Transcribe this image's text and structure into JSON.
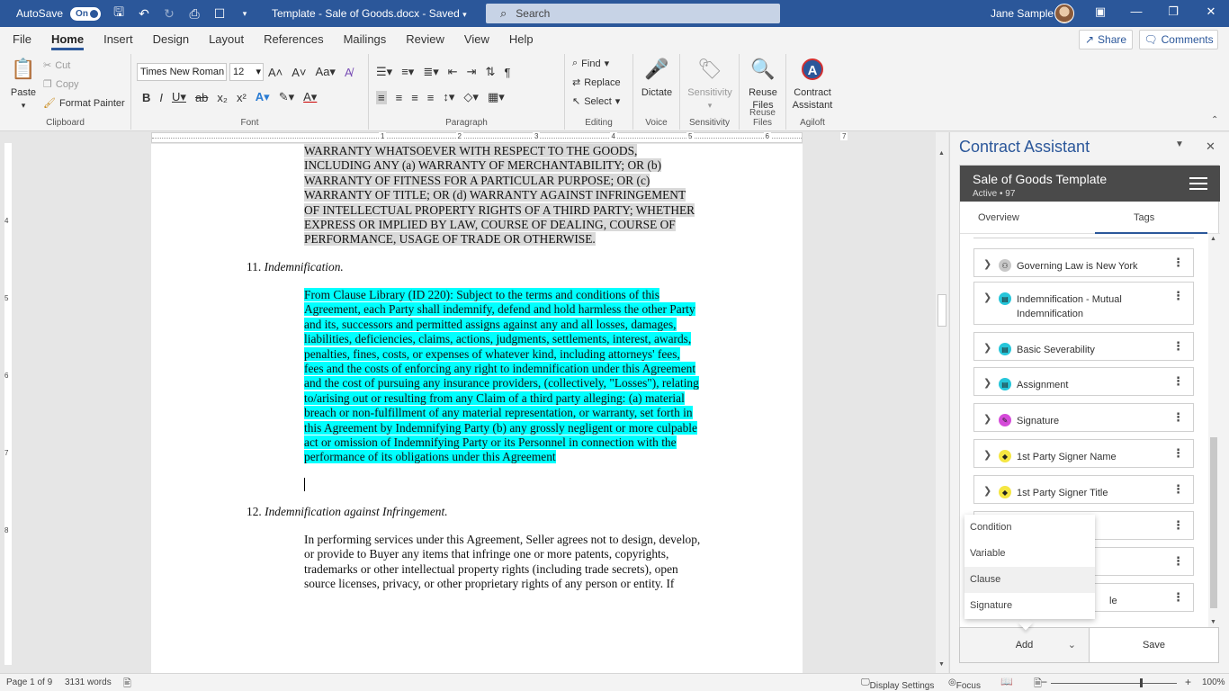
{
  "titlebar": {
    "autosave_label": "AutoSave",
    "autosave_state": "On",
    "doc_title": "Template - Sale of Goods.docx  -  Saved",
    "search_placeholder": "Search",
    "user_name": "Jane Sample",
    "accent_color": "#2b579a"
  },
  "ribbon_tabs": [
    "File",
    "Home",
    "Insert",
    "Design",
    "Layout",
    "References",
    "Mailings",
    "Review",
    "View",
    "Help"
  ],
  "share": {
    "share_label": "Share",
    "comments_label": "Comments"
  },
  "clipboard": {
    "paste": "Paste",
    "cut": "Cut",
    "copy": "Copy",
    "format_painter": "Format Painter",
    "label": "Clipboard"
  },
  "font": {
    "name": "Times New Roman",
    "size": "12",
    "label": "Font"
  },
  "paragraph": {
    "label": "Paragraph"
  },
  "editing": {
    "find": "Find",
    "replace": "Replace",
    "select": "Select",
    "label": "Editing"
  },
  "voice": {
    "dictate": "Dictate",
    "label": "Voice"
  },
  "sensitivity": {
    "button": "Sensitivity",
    "label": "Sensitivity"
  },
  "reuse": {
    "button": "Reuse Files",
    "label": "Reuse Files"
  },
  "agiloft": {
    "button": "Contract Assistant",
    "label": "Agiloft"
  },
  "ruler": {
    "numbers": [
      "1",
      "2",
      "3",
      "4",
      "5",
      "6",
      "7"
    ],
    "v_numbers": [
      "4",
      "5",
      "6",
      "7",
      "8"
    ]
  },
  "document": {
    "warranty_lines": [
      "WARRANTY WHATSOEVER WITH RESPECT TO THE GOODS,",
      "INCLUDING ANY (a) WARRANTY OF MERCHANTABILITY; OR (b)",
      "WARRANTY OF FITNESS FOR A PARTICULAR PURPOSE; OR (c)",
      "WARRANTY OF TITLE; OR (d) WARRANTY AGAINST INFRINGEMENT",
      "OF INTELLECTUAL PROPERTY RIGHTS OF A THIRD PARTY; WHETHER",
      "EXPRESS OR IMPLIED BY LAW, COURSE OF DEALING, COURSE OF",
      "PERFORMANCE, USAGE OF TRADE OR OTHERWISE."
    ],
    "section11_num": "11.",
    "section11_title": "Indemnification.",
    "clause_lines": [
      "From Clause Library (ID 220): Subject to the terms and conditions of this",
      "Agreement, each Party shall indemnify, defend and hold harmless the other Party",
      "and its, successors and permitted assigns against any and all losses, damages,",
      "liabilities, deficiencies, claims, actions, judgments, settlements, interest, awards,",
      "penalties, fines, costs, or expenses of whatever kind, including attorneys' fees,",
      "fees and the costs of enforcing any right to indemnification under this Agreement",
      "and the cost of pursuing any insurance providers, (collectively, \"Losses\"), relating",
      "to/arising out or resulting from any Claim of a third party alleging: (a) material",
      "breach or non-fulfillment of any material representation, or warranty, set forth in",
      "this Agreement by Indemnifying Party (b) any grossly negligent or more culpable",
      "act or omission of Indemnifying Party or its Personnel in connection with the",
      "performance of its obligations under this Agreement"
    ],
    "section12_num": "12.",
    "section12_title": "Indemnification against Infringement.",
    "section12_lines": [
      "In performing services under this Agreement, Seller agrees not to design, develop,",
      "or provide to Buyer any items that infringe one or more patents, copyrights,",
      "trademarks or other intellectual property rights (including trade secrets), open",
      "source licenses, privacy, or other proprietary rights of any person or entity. If"
    ],
    "highlight_cyan": "#00ffff",
    "highlight_gray": "#d9d9d9"
  },
  "statusbar": {
    "page": "Page 1 of 9",
    "words": "3131 words",
    "display_settings": "Display Settings",
    "focus": "Focus",
    "zoom": "100%"
  },
  "pane": {
    "title": "Contract Assistant",
    "card_title": "Sale of Goods Template",
    "card_subtitle": "Active • 97",
    "tabs": [
      "Overview",
      "Tags"
    ],
    "active_tab": "Tags",
    "tags": [
      {
        "label": "Governing Law is New York",
        "icon": "condition-icon",
        "color": "#c8c8c8"
      },
      {
        "label": "Indemnification - Mutual Indemnification",
        "icon": "clause-icon",
        "color": "#26c6da"
      },
      {
        "label": "Basic Severability",
        "icon": "clause-icon",
        "color": "#26c6da"
      },
      {
        "label": "Assignment",
        "icon": "clause-icon",
        "color": "#26c6da"
      },
      {
        "label": "Signature",
        "icon": "signature-icon",
        "color": "#d54bd9"
      },
      {
        "label": "1st Party Signer Name",
        "icon": "variable-icon",
        "color": "#f5e642"
      },
      {
        "label": "1st Party Signer Title",
        "icon": "variable-icon",
        "color": "#f5e642"
      },
      {
        "label": "",
        "icon": "",
        "color": ""
      },
      {
        "label": "",
        "icon": "",
        "color": ""
      },
      {
        "label": "le",
        "icon": "",
        "color": ""
      }
    ],
    "add_menu": [
      "Condition",
      "Variable",
      "Clause",
      "Signature"
    ],
    "add_label": "Add",
    "save_label": "Save"
  }
}
